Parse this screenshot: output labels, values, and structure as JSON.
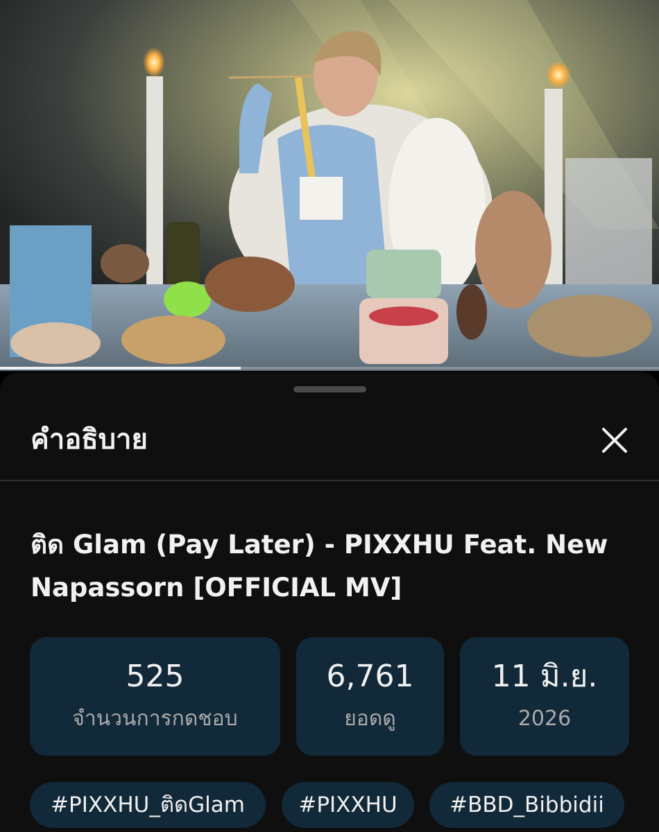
{
  "video": {
    "progress": 0.365
  },
  "sheet": {
    "title": "คำอธิบาย",
    "close_icon": "close-icon"
  },
  "video_title": "ติด Glam (Pay Later) - PIXXHU Feat. New Napassorn [OFFICIAL MV]",
  "stats": {
    "likes": {
      "value": "525",
      "label": "จำนวนการกดชอบ"
    },
    "views": {
      "value": "6,761",
      "label": "ยอดดู"
    },
    "date": {
      "value": "11 มิ.ย.",
      "label": "2026"
    }
  },
  "hashtags": [
    "#PIXXHU_ติดGlam",
    "#PIXXHU",
    "#BBD_Bibbidii"
  ],
  "colors": {
    "sheet_bg": "#0f0f0f",
    "chip_bg": "#12293a",
    "secondary_text": "#aaaaaa"
  }
}
